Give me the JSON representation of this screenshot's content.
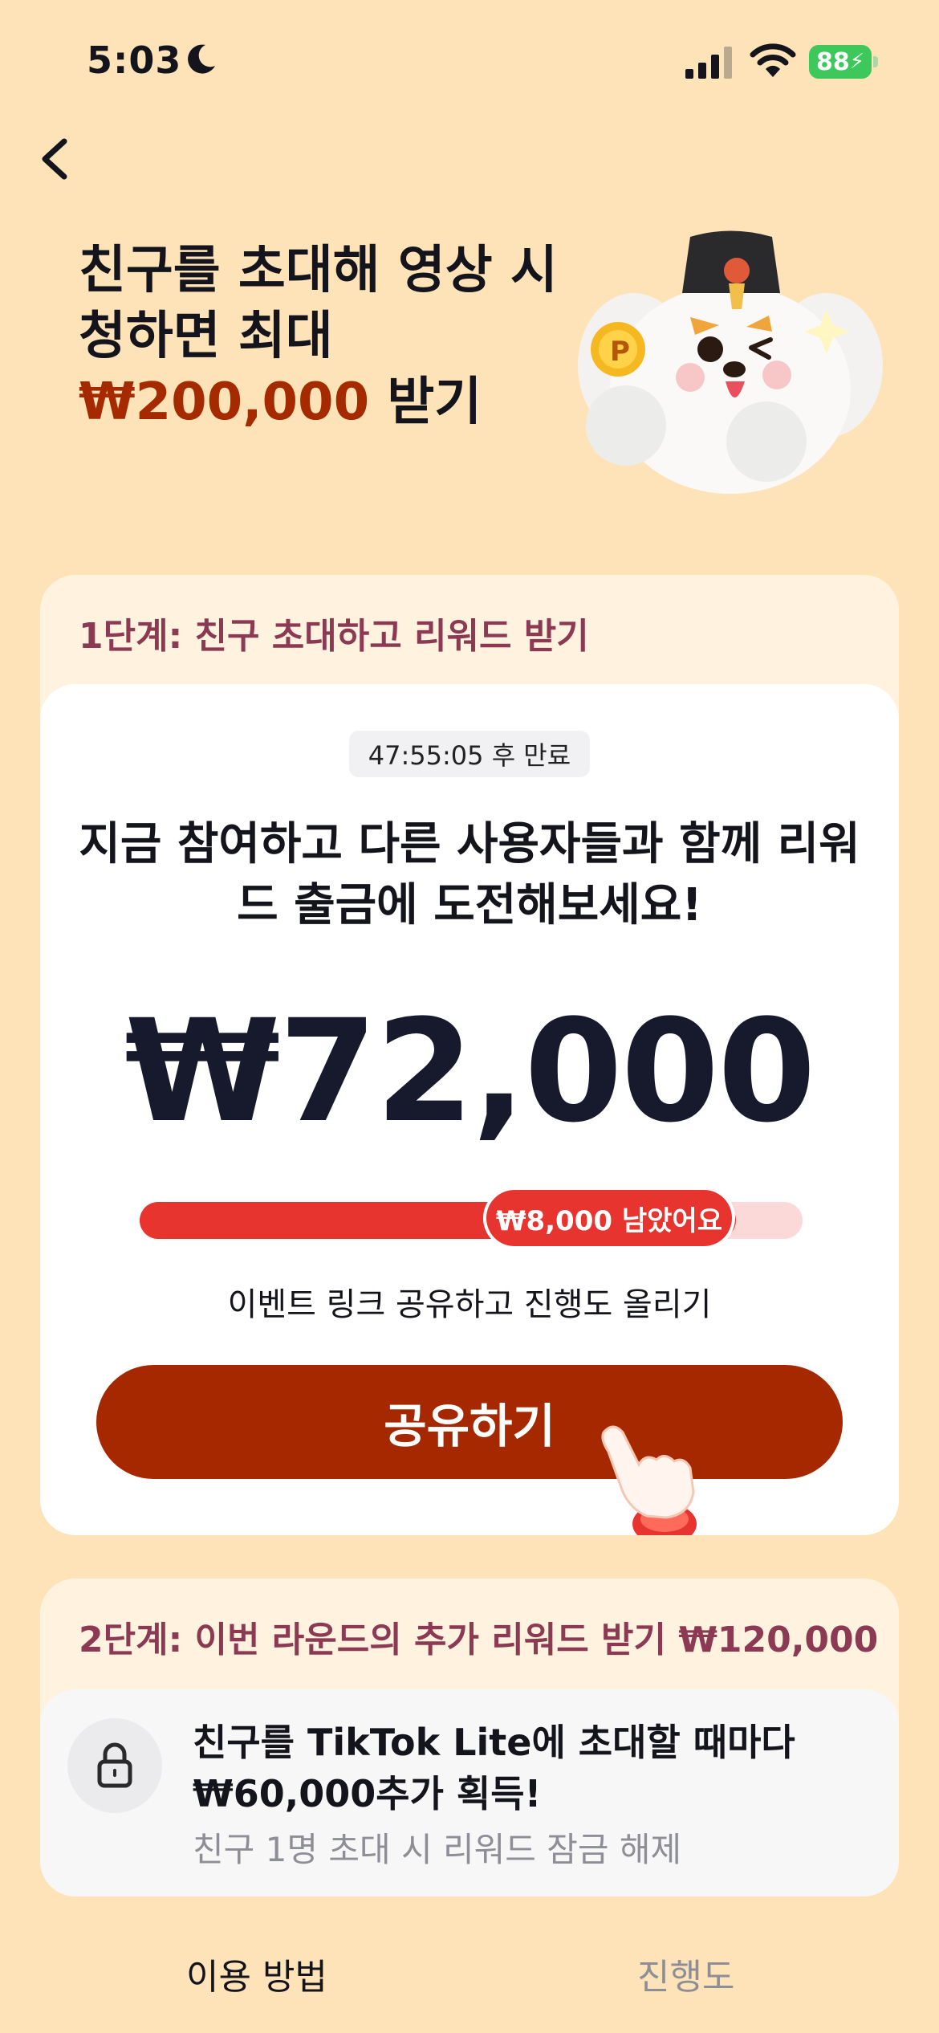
{
  "status_bar": {
    "time": "5:03",
    "battery": "88",
    "icons": [
      "moon-icon",
      "signal-icon",
      "wifi-icon",
      "battery-icon"
    ]
  },
  "nav": {
    "back_icon": "chevron-left-icon"
  },
  "hero": {
    "title_line1": "친구를 초대해 영상 시",
    "title_line2": "청하면 최대",
    "amount": "₩200,000",
    "title_suffix": " 받기",
    "mascot_icon": "mascot-dog-illustration"
  },
  "step1": {
    "heading": "1단계: 친구 초대하고 리워드 받기",
    "timer": "47:55:05 후 만료",
    "invite_text": "지금 참여하고 다른 사용자들과 함께 리워드 출금에 도전해보세요!",
    "amount": "₩72,000",
    "progress_fraction": 0.9,
    "remaining_label": "₩8,000 남았어요",
    "share_hint": "이벤트 링크 공유하고 진행도 올리기",
    "share_button": "공유하기"
  },
  "step2": {
    "heading": "2단계: 이번 라운드의 추가 리워드 받기 ₩120,000",
    "reward_title": "친구를 TikTok Lite에 초대할 때마다 ₩60,000추가 획득!",
    "reward_sub": "친구 1명 초대 시 리워드 잠금 해제",
    "icon": "lock-icon"
  },
  "tabs": [
    {
      "label": "이용 방법",
      "active": true
    },
    {
      "label": "진행도",
      "active": false
    }
  ],
  "colors": {
    "background": "#ffe3b8",
    "accent_red": "#e8342f",
    "brand_dark_red": "#a62800",
    "heading_plum": "#8c3a53",
    "battery_green": "#3ec85c"
  }
}
